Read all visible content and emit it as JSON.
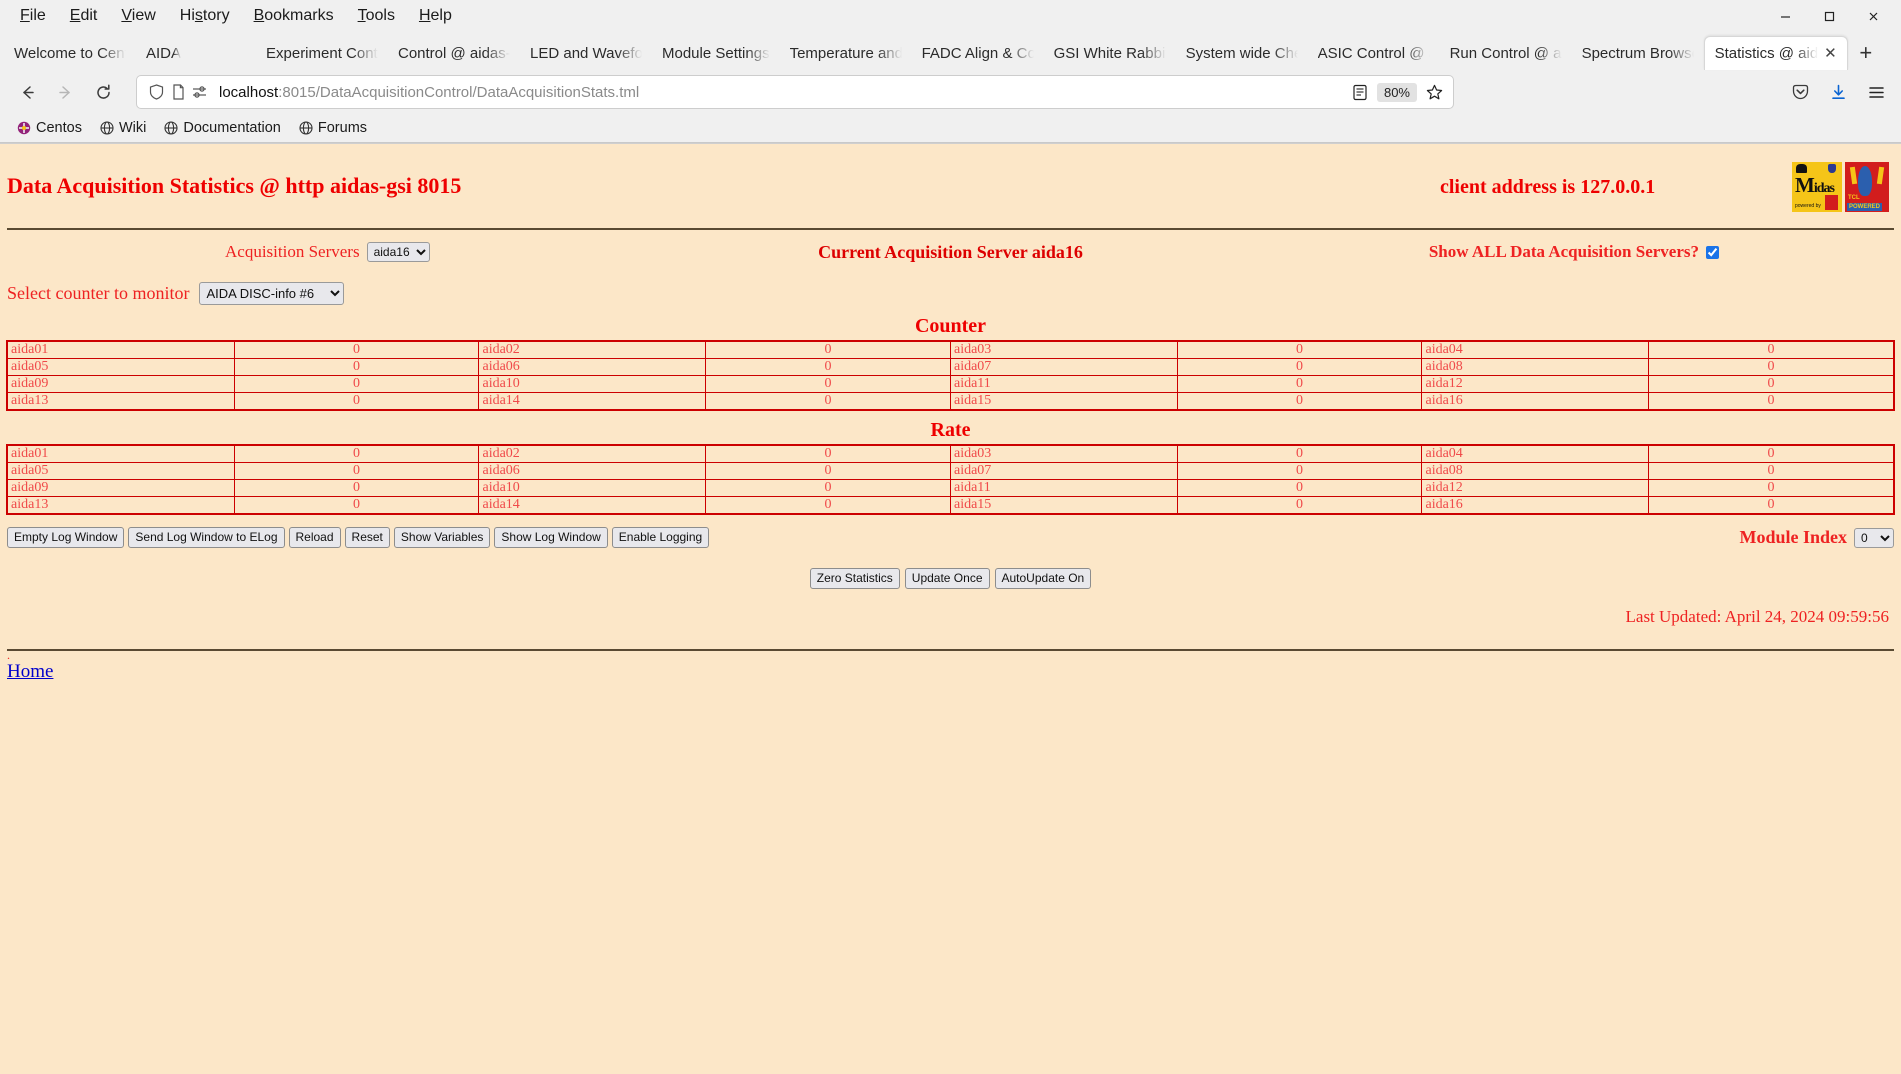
{
  "browser": {
    "menu": [
      "File",
      "Edit",
      "View",
      "History",
      "Bookmarks",
      "Tools",
      "Help"
    ],
    "window_controls": {
      "minimize": "—",
      "maximize": "☐",
      "close": "✕"
    },
    "tabs": [
      {
        "label": "Welcome to Cent",
        "active": false
      },
      {
        "label": "AIDA",
        "active": false
      },
      {
        "label": "",
        "active": false
      },
      {
        "label": "Experiment Contr",
        "active": false
      },
      {
        "label": "Control @ aidas-",
        "active": false
      },
      {
        "label": "LED and Wavefor",
        "active": false
      },
      {
        "label": "Module Settings ",
        "active": false
      },
      {
        "label": "Temperature and",
        "active": false
      },
      {
        "label": "FADC Align & Co",
        "active": false
      },
      {
        "label": "GSI White Rabbit",
        "active": false
      },
      {
        "label": "System wide Che",
        "active": false
      },
      {
        "label": "ASIC Control @ a",
        "active": false
      },
      {
        "label": "Run Control @ ai",
        "active": false
      },
      {
        "label": "Spectrum Browse",
        "active": false
      },
      {
        "label": "Statistics @ aid",
        "active": true
      }
    ],
    "new_tab_label": "+",
    "tab_close_label": "✕",
    "url_host": "localhost",
    "url_path": ":8015/DataAcquisitionControl/DataAcquisitionStats.tml",
    "zoom_level": "80%",
    "bookmarks": [
      {
        "label": "Centos",
        "icon": "centos-icon"
      },
      {
        "label": "Wiki",
        "icon": "globe-icon"
      },
      {
        "label": "Documentation",
        "icon": "globe-icon"
      },
      {
        "label": "Forums",
        "icon": "globe-icon"
      }
    ]
  },
  "page": {
    "title": "Data Acquisition Statistics @ http aidas-gsi 8015",
    "client_address": "client address is 127.0.0.1",
    "acquisition_servers_label": "Acquisition Servers",
    "acquisition_servers_value": "aida16",
    "current_server": "Current Acquisition Server aida16",
    "show_all_label": "Show ALL Data Acquisition Servers?",
    "show_all_checked": true,
    "counter_select_label": "Select counter to monitor",
    "counter_select_value": "AIDA DISC-info #6",
    "counter_title": "Counter",
    "rate_title": "Rate",
    "counter_rows": [
      [
        [
          "aida01",
          "0"
        ],
        [
          "aida02",
          "0"
        ],
        [
          "aida03",
          "0"
        ],
        [
          "aida04",
          "0"
        ]
      ],
      [
        [
          "aida05",
          "0"
        ],
        [
          "aida06",
          "0"
        ],
        [
          "aida07",
          "0"
        ],
        [
          "aida08",
          "0"
        ]
      ],
      [
        [
          "aida09",
          "0"
        ],
        [
          "aida10",
          "0"
        ],
        [
          "aida11",
          "0"
        ],
        [
          "aida12",
          "0"
        ]
      ],
      [
        [
          "aida13",
          "0"
        ],
        [
          "aida14",
          "0"
        ],
        [
          "aida15",
          "0"
        ],
        [
          "aida16",
          "0"
        ]
      ]
    ],
    "rate_rows": [
      [
        [
          "aida01",
          "0"
        ],
        [
          "aida02",
          "0"
        ],
        [
          "aida03",
          "0"
        ],
        [
          "aida04",
          "0"
        ]
      ],
      [
        [
          "aida05",
          "0"
        ],
        [
          "aida06",
          "0"
        ],
        [
          "aida07",
          "0"
        ],
        [
          "aida08",
          "0"
        ]
      ],
      [
        [
          "aida09",
          "0"
        ],
        [
          "aida10",
          "0"
        ],
        [
          "aida11",
          "0"
        ],
        [
          "aida12",
          "0"
        ]
      ],
      [
        [
          "aida13",
          "0"
        ],
        [
          "aida14",
          "0"
        ],
        [
          "aida15",
          "0"
        ],
        [
          "aida16",
          "0"
        ]
      ]
    ],
    "log_buttons": [
      "Empty Log Window",
      "Send Log Window to ELog",
      "Reload",
      "Reset",
      "Show Variables",
      "Show Log Window",
      "Enable Logging"
    ],
    "module_index_label": "Module Index",
    "module_index_value": "0",
    "action_buttons": [
      "Zero Statistics",
      "Update Once",
      "AutoUpdate On"
    ],
    "last_updated": "Last Updated: April 24, 2024 09:59:56",
    "footer_dot": ".",
    "home_link": "Home",
    "colors": {
      "page_bg": "#fce7c8",
      "heading_red": "#ee0000",
      "table_border": "#cc0000",
      "table_text": "#f04a4a",
      "link_blue": "#0000cc",
      "rule": "#5a4a32"
    }
  }
}
